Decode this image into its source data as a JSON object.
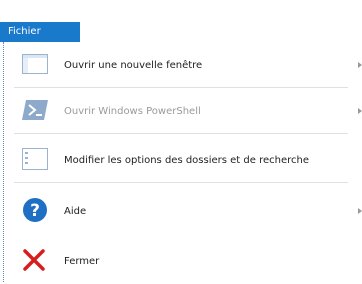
{
  "tab": {
    "label": "Fichier",
    "color": "#1979ca"
  },
  "menu": {
    "items": [
      {
        "label": "Ouvrir une nouvelle fenêtre",
        "icon": "window-icon",
        "enabled": true,
        "submenu": true
      },
      {
        "label": "Ouvrir Windows PowerShell",
        "icon": "powershell-icon",
        "enabled": false,
        "submenu": true
      },
      {
        "label": "Modifier les options des dossiers et de recherche",
        "icon": "folder-options-icon",
        "enabled": true,
        "submenu": false
      },
      {
        "label": "Aide",
        "icon": "help-icon",
        "enabled": true,
        "submenu": true
      },
      {
        "label": "Fermer",
        "icon": "close-icon",
        "enabled": true,
        "submenu": false
      }
    ]
  }
}
